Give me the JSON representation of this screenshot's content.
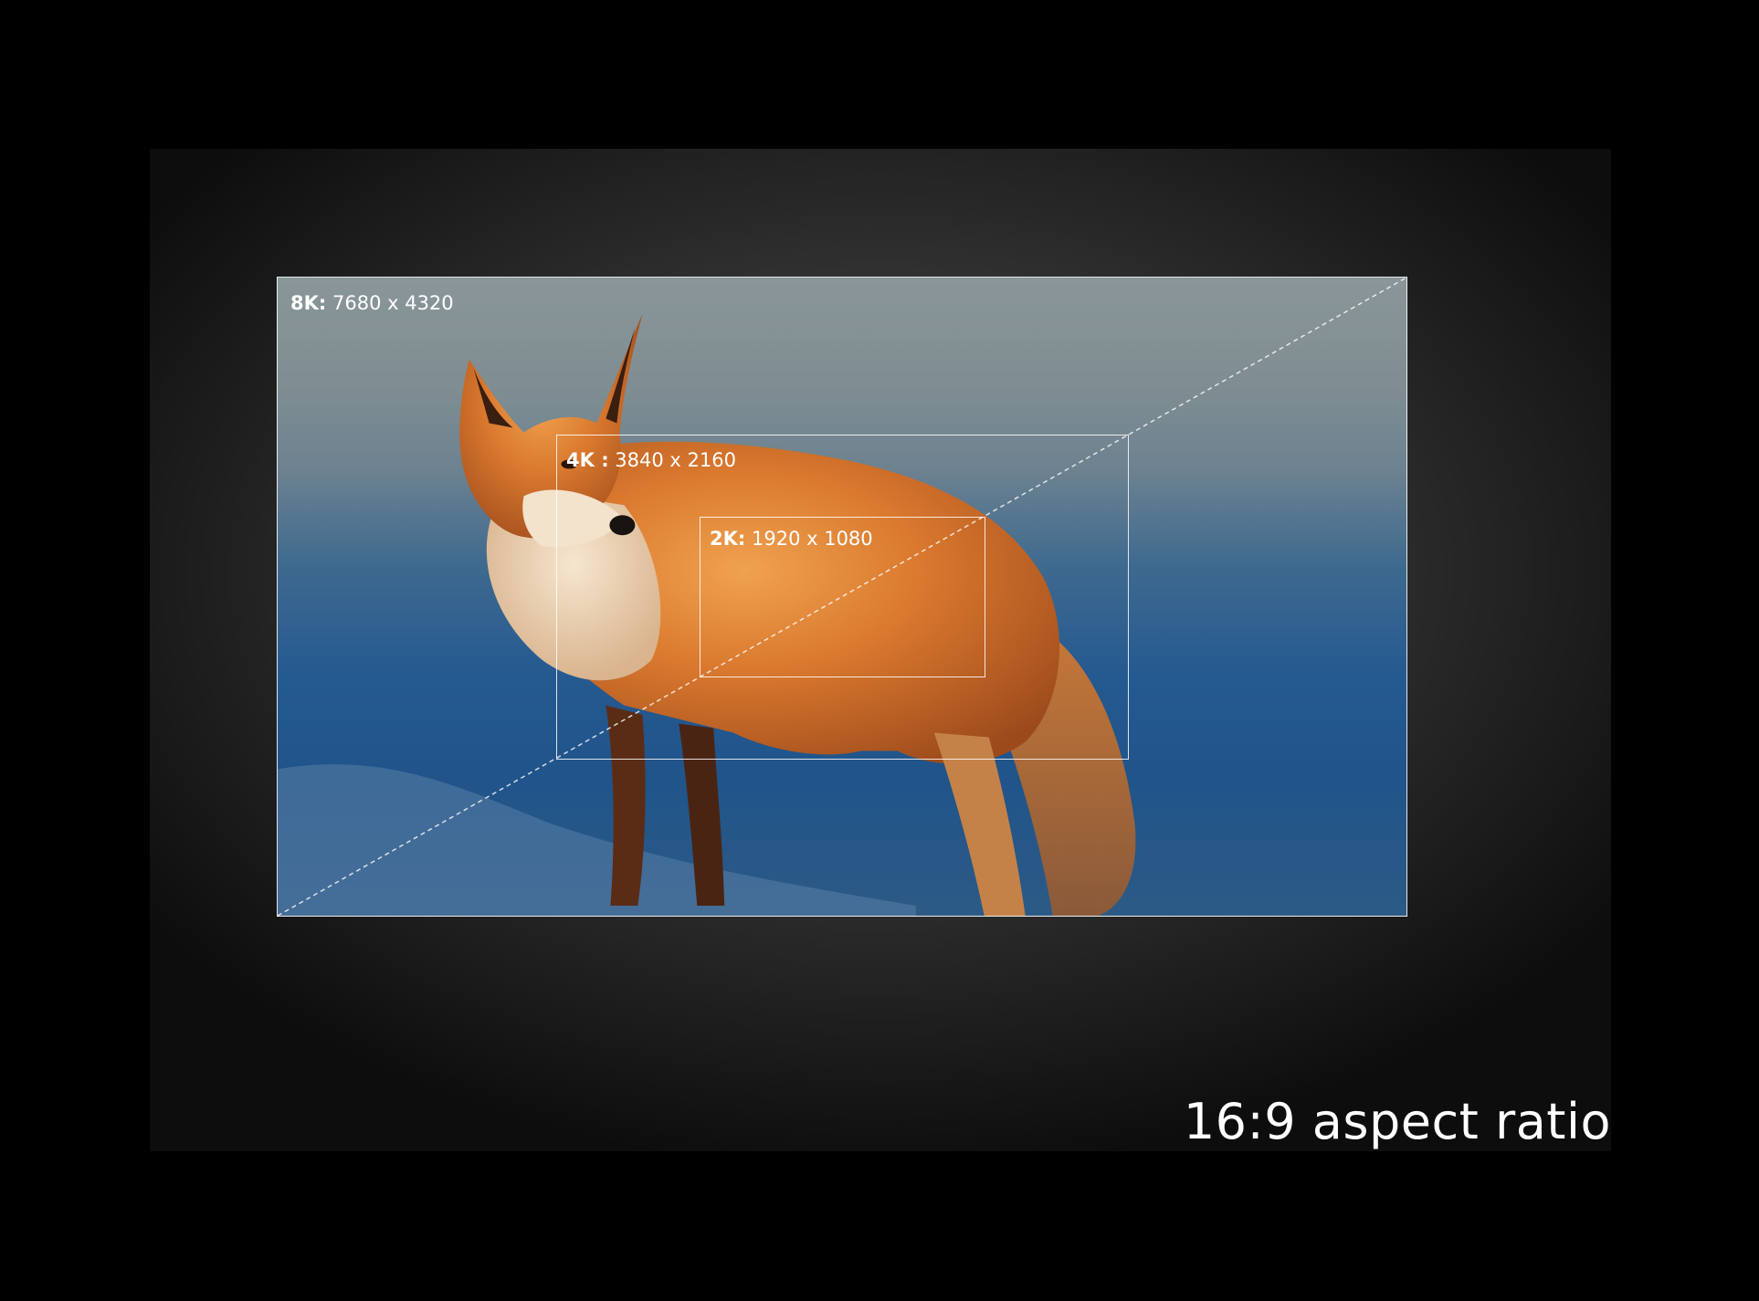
{
  "resolutions": [
    {
      "tier": "8K:",
      "dims": "7680 x 4320"
    },
    {
      "tier": "4K :",
      "dims": "3840 x 2160"
    },
    {
      "tier": "2K:",
      "dims": "1920 x 1080"
    }
  ],
  "caption": "16:9 aspect ratio",
  "colors": {
    "background": "#000000",
    "frame": "#ffffff",
    "fox": "#d9782e",
    "sky": "#8a9698",
    "snow_blue": "#255a90"
  }
}
